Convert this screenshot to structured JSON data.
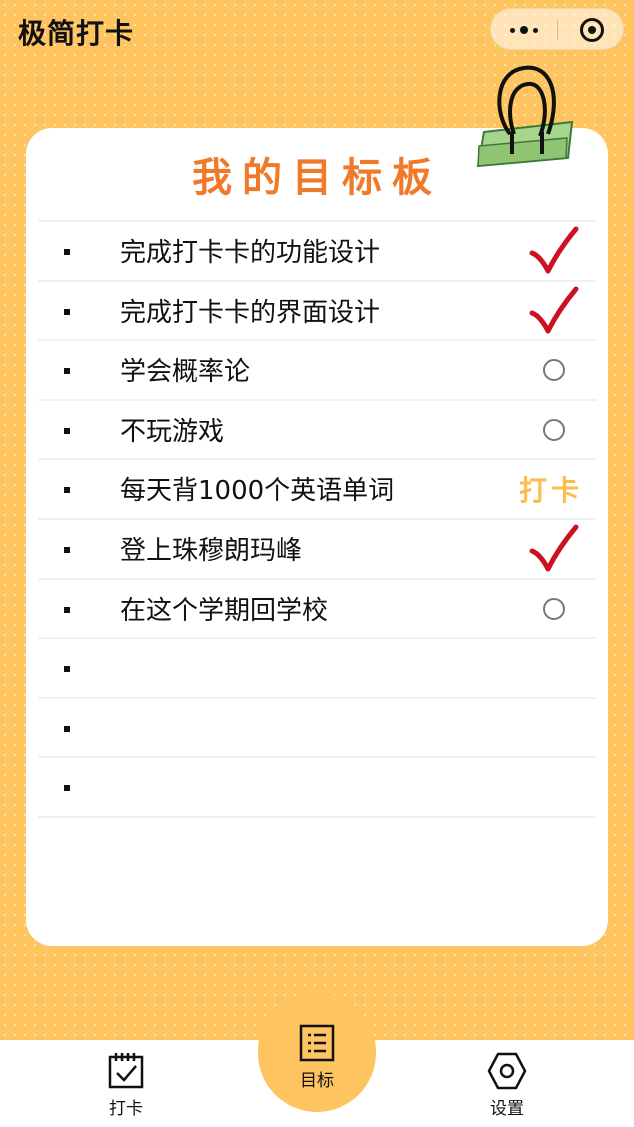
{
  "header": {
    "app_title": "极简打卡"
  },
  "board": {
    "title": "我的目标板",
    "items": [
      {
        "text": "完成打卡卡的功能设计",
        "status": "done"
      },
      {
        "text": "完成打卡卡的界面设计",
        "status": "done"
      },
      {
        "text": "学会概率论",
        "status": "todo"
      },
      {
        "text": "不玩游戏",
        "status": "todo"
      },
      {
        "text": "每天背1000个英语单词",
        "status": "punch",
        "action_label": "打卡"
      },
      {
        "text": "登上珠穆朗玛峰",
        "status": "done"
      },
      {
        "text": "在这个学期回学校",
        "status": "todo"
      },
      {
        "text": "",
        "status": "empty"
      },
      {
        "text": "",
        "status": "empty"
      },
      {
        "text": "",
        "status": "empty"
      }
    ]
  },
  "tabbar": {
    "tabs": [
      {
        "label": "打卡",
        "icon": "calendar-check-icon"
      },
      {
        "label": "目标",
        "icon": "list-icon",
        "active": true
      },
      {
        "label": "设置",
        "icon": "hexagon-settings-icon"
      }
    ]
  },
  "colors": {
    "background": "#fdc460",
    "title": "#f07a2a",
    "check": "#cc1122",
    "punch": "#fcbd4d"
  }
}
